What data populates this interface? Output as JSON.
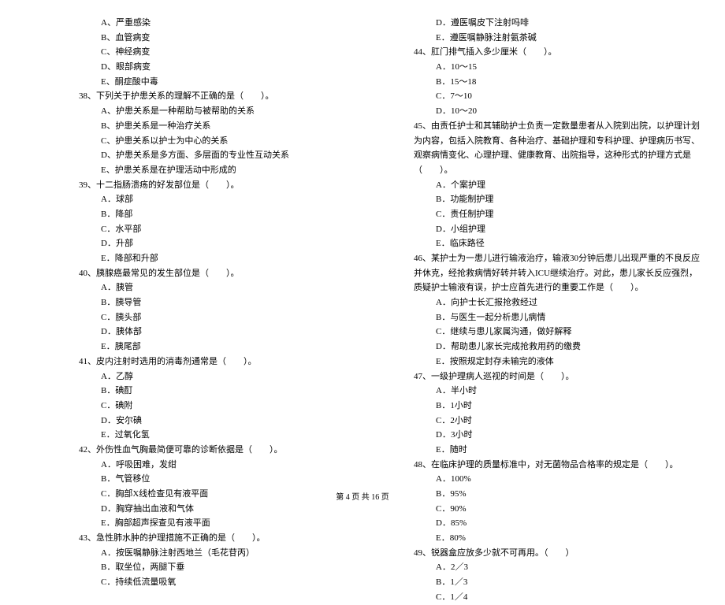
{
  "leftColumn": {
    "q37": {
      "options": {
        "a": "A、严重感染",
        "b": "B、血管病变",
        "c": "C、神经病变",
        "d": "D、眼部病变",
        "e": "E、酮症酸中毒"
      }
    },
    "q38": {
      "stem": "38、下列关于护患关系的理解不正确的是（　　）。",
      "options": {
        "a": "A、护患关系是一种帮助与被帮助的关系",
        "b": "B、护患关系是一种治疗关系",
        "c": "C、护患关系以护士为中心的关系",
        "d": "D、护患关系是多方面、多层面的专业性互动关系",
        "e": "E、护患关系是在护理活动中形成的"
      }
    },
    "q39": {
      "stem": "39、十二指肠溃疡的好发部位是（　　）。",
      "options": {
        "a": "A．球部",
        "b": "B．降部",
        "c": "C．水平部",
        "d": "D．升部",
        "e": "E．降部和升部"
      }
    },
    "q40": {
      "stem": "40、胰腺癌最常见的发生部位是（　　）。",
      "options": {
        "a": "A．胰管",
        "b": "B．胰导管",
        "c": "C．胰头部",
        "d": "D．胰体部",
        "e": "E．胰尾部"
      }
    },
    "q41": {
      "stem": "41、皮内注射时选用的消毒剂通常是（　　）。",
      "options": {
        "a": "A．乙醇",
        "b": "B．碘酊",
        "c": "C．碘附",
        "d": "D．安尔碘",
        "e": "E．过氧化氢"
      }
    },
    "q42": {
      "stem": "42、外伤性血气胸最简便可靠的诊断依据是（　　）。",
      "options": {
        "a": "A．呼吸困难，发绀",
        "b": "B．气管移位",
        "c": "C．胸部X线检查见有液平面",
        "d": "D．胸穿抽出血液和气体",
        "e": "E．胸部超声探查见有液平面"
      }
    },
    "q43": {
      "stem": "43、急性肺水肿的护理措施不正确的是（　　）。",
      "options": {
        "a": "A．按医嘱静脉注射西地兰（毛花苷丙）",
        "b": "B．取坐位，两腿下垂",
        "c": "C．持续低流量吸氧"
      }
    }
  },
  "rightColumn": {
    "q43": {
      "options": {
        "d": "D．遵医嘱皮下注射吗啡",
        "e": "E．遵医嘱静脉注射氨茶碱"
      }
    },
    "q44": {
      "stem": "44、肛门排气插入多少厘米（　　）。",
      "options": {
        "a": "A．10～15",
        "b": "B．15～18",
        "c": "C．7～10",
        "d": "D．10～20"
      }
    },
    "q45": {
      "stem": "45、由责任护士和其辅助护士负责一定数量患者从入院到出院，以护理计划为内容，包括入院教育、各种治疗、基础护理和专科护理、护理病历书写、观察病情变化、心理护理、健康教育、出院指导，这种形式的护理方式是（　　）。",
      "options": {
        "a": "A．个案护理",
        "b": "B．功能制护理",
        "c": "C．责任制护理",
        "d": "D．小组护理",
        "e": "E．临床路径"
      }
    },
    "q46": {
      "stem": "46、某护士为一患儿进行输液治疗，输液30分钟后患儿出现严重的不良反应并休克，经抢救病情好转并转入ICU继续治疗。对此，患儿家长反应强烈，质疑护士输液有误，护士应首先进行的重要工作是（　　）。",
      "options": {
        "a": "A．向护士长汇报抢救经过",
        "b": "B．与医生一起分析患儿病情",
        "c": "C．继续与患儿家属沟通，做好解释",
        "d": "D．帮助患儿家长完成抢救用药的缴费",
        "e": "E．按照规定封存未输完的液体"
      }
    },
    "q47": {
      "stem": "47、一级护理病人巡视的时间是（　　）。",
      "options": {
        "a": "A．半小时",
        "b": "B．1小时",
        "c": "C．2小时",
        "d": "D．3小时",
        "e": "E．随时"
      }
    },
    "q48": {
      "stem": "48、在临床护理的质量标准中，对无菌物品合格率的规定是（　　）。",
      "options": {
        "a": "A．100%",
        "b": "B．95%",
        "c": "C．90%",
        "d": "D．85%",
        "e": "E．80%"
      }
    },
    "q49": {
      "stem": "49、锐器盒应放多少就不可再用。（　　）",
      "options": {
        "a": "A．2／3",
        "b": "B．1／3",
        "c": "C．1／4"
      }
    }
  },
  "footer": "第 4 页 共 16 页"
}
